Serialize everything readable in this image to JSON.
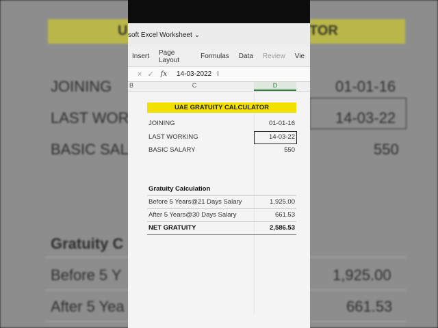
{
  "window": {
    "title": "soft Excel Worksheet",
    "ribbon_tabs": [
      "Insert",
      "Page Layout",
      "Formulas",
      "Data",
      "Review",
      "Vie"
    ]
  },
  "formula_bar": {
    "cancel_symbol": "×",
    "confirm_symbol": "✓",
    "fx_label": "fx",
    "value": "14-03-2022",
    "cursor": "I"
  },
  "columns": {
    "b": "B",
    "c": "C",
    "d": "D"
  },
  "sheet": {
    "banner": "UAE GRATUITY CALCULATOR",
    "joining_label": "JOINING",
    "joining_value": "01-01-16",
    "last_working_label": "LAST WORKING",
    "last_working_value": "14-03-22",
    "basic_salary_label": "BASIC SALARY",
    "basic_salary_value": "550",
    "section_title": "Gratuity Calculation",
    "before_label": "Before 5 Years@21 Days Salary",
    "before_value": "1,925.00",
    "after_label": "After 5 Years@30 Days Salary",
    "after_value": "661.53",
    "net_label": "NET GRATUITY",
    "net_value": "2,586.53"
  },
  "background": {
    "banner_left": "U",
    "banner_right": "TOR",
    "joining": "JOINING",
    "joining_value": "01-01-16",
    "last_working": "LAST WOR",
    "last_working_value": "14-03-22",
    "basic_salary": "BASIC SALA",
    "basic_salary_value": "550",
    "gratuity": "Gratuity C",
    "before": "Before 5 Y",
    "before_value": "1,925.00",
    "after": "After 5 Yea",
    "after_value": "661.53"
  }
}
